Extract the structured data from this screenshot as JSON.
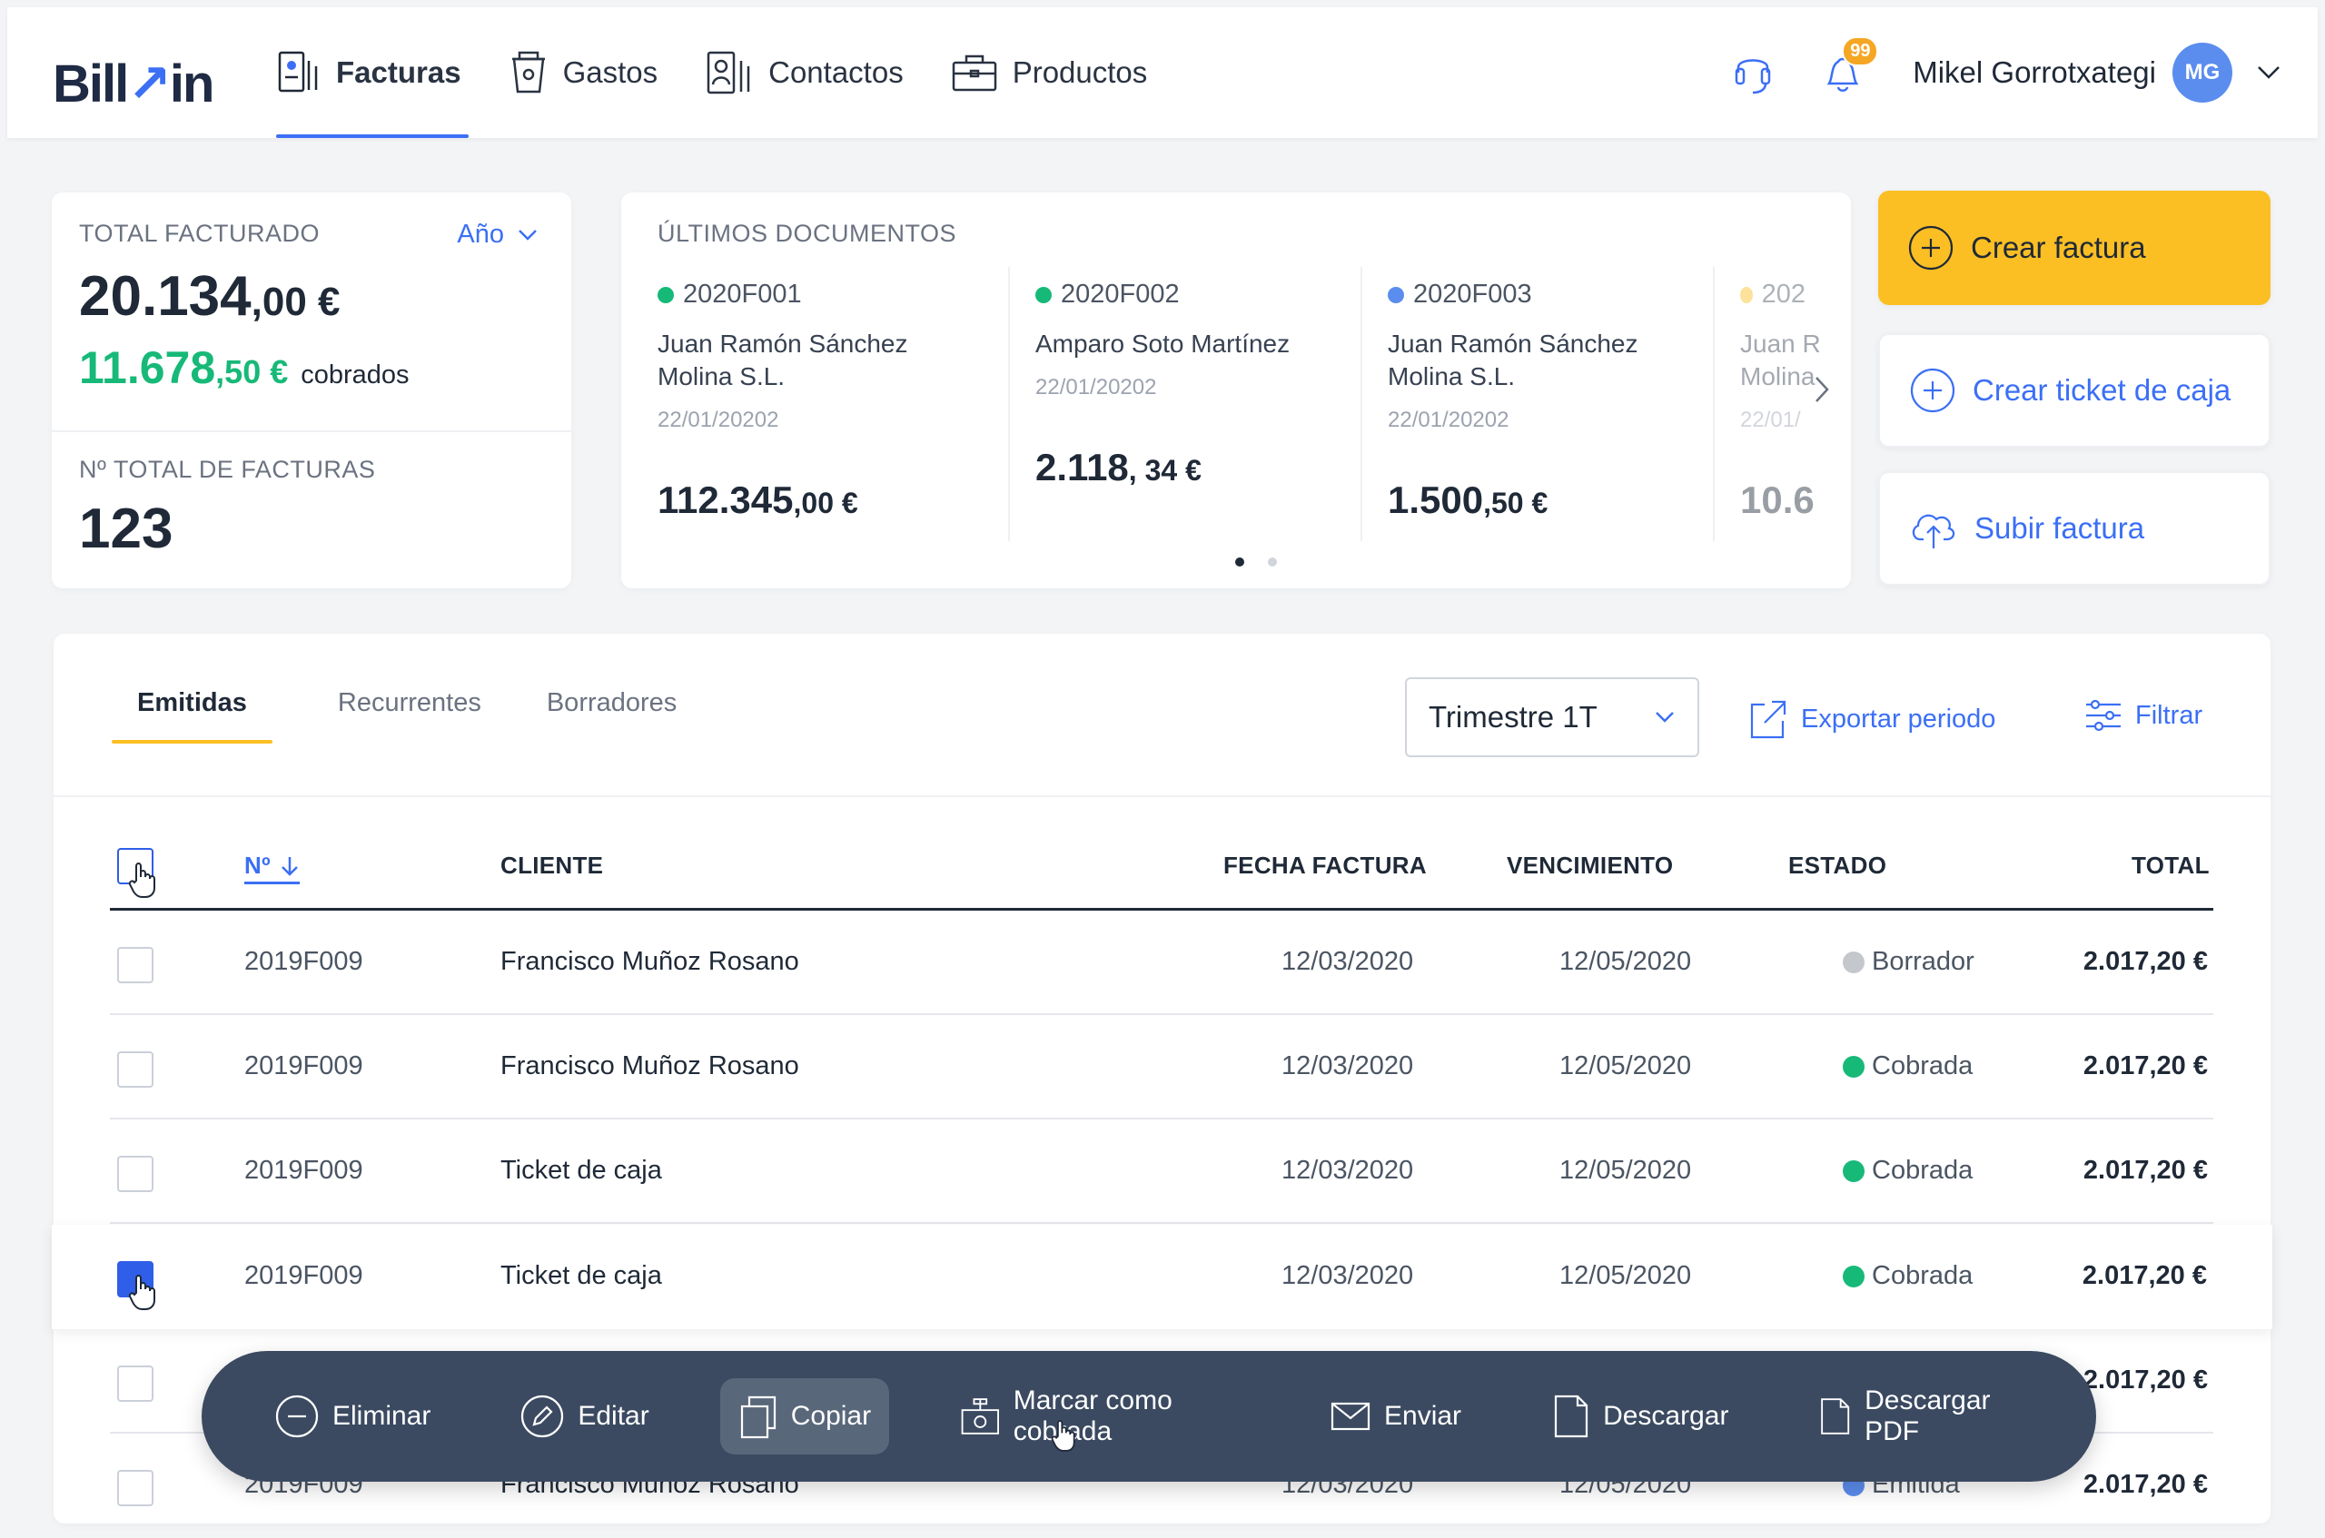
{
  "app": {
    "logo_text": "Billin"
  },
  "nav": {
    "items": [
      {
        "label": "Facturas",
        "active": true
      },
      {
        "label": "Gastos"
      },
      {
        "label": "Contactos"
      },
      {
        "label": "Productos"
      }
    ]
  },
  "header": {
    "notifications_count": "99",
    "user_name": "Mikel Gorrotxategi",
    "user_initials": "MG"
  },
  "summary": {
    "total_label": "TOTAL FACTURADO",
    "period_label": "Año",
    "total_int": "20.134",
    "total_dec": ",00 €",
    "paid_int": "11.678",
    "paid_dec": ",50 €",
    "paid_label": "cobrados",
    "count_label": "Nº TOTAL DE FACTURAS",
    "count_value": "123"
  },
  "recent_docs": {
    "title": "ÚLTIMOS DOCUMENTOS",
    "items": [
      {
        "number": "2020F001",
        "client": "Juan Ramón Sánchez Molina S.L.",
        "date": "22/01/20202",
        "amount_int": "112.345",
        "amount_dec": ",00 €",
        "color": "#17b978"
      },
      {
        "number": "2020F002",
        "client": "Amparo Soto Martínez",
        "date": "22/01/20202",
        "amount_int": "2.118",
        "amount_dec": ", 34 €",
        "color": "#17b978"
      },
      {
        "number": "2020F003",
        "client": "Juan Ramón Sánchez Molina S.L.",
        "date": "22/01/20202",
        "amount_int": "1.500",
        "amount_dec": ",50 €",
        "color": "#5b8def"
      },
      {
        "number": "202",
        "client": "Juan R Molina",
        "date": "22/01/",
        "amount_int": "10.6",
        "amount_dec": "",
        "color": "#fbbf24"
      }
    ]
  },
  "actions": {
    "create_invoice": "Crear factura",
    "create_ticket": "Crear ticket de caja",
    "upload_invoice": "Subir factura"
  },
  "table": {
    "tabs": [
      {
        "label": "Emitidas",
        "active": true
      },
      {
        "label": "Recurrentes"
      },
      {
        "label": "Borradores"
      }
    ],
    "period_value": "Trimestre 1T",
    "export_label": "Exportar periodo",
    "filter_label": "Filtrar",
    "columns": {
      "number": "Nº",
      "client": "CLIENTE",
      "date": "FECHA FACTURA",
      "due": "VENCIMIENTO",
      "status": "ESTADO",
      "total": "TOTAL"
    },
    "rows": [
      {
        "number": "2019F009",
        "client": "Francisco Muñoz Rosano",
        "date": "12/03/2020",
        "due": "12/05/2020",
        "status": "Borrador",
        "status_color": "#c4c7cc",
        "total": "2.017,20 €",
        "checked": false
      },
      {
        "number": "2019F009",
        "client": "Francisco Muñoz Rosano",
        "date": "12/03/2020",
        "due": "12/05/2020",
        "status": "Cobrada",
        "status_color": "#17b978",
        "total": "2.017,20 €",
        "checked": false
      },
      {
        "number": "2019F009",
        "client": "Ticket de caja",
        "date": "12/03/2020",
        "due": "12/05/2020",
        "status": "Cobrada",
        "status_color": "#17b978",
        "total": "2.017,20 €",
        "checked": false
      },
      {
        "number": "2019F009",
        "client": "Ticket de caja",
        "date": "12/03/2020",
        "due": "12/05/2020",
        "status": "Cobrada",
        "status_color": "#17b978",
        "total": "2.017,20 €",
        "checked": true
      },
      {
        "number": "",
        "client": "",
        "date": "",
        "due": "",
        "status": "",
        "status_color": "#17b978",
        "total": "2.017,20 €",
        "checked": false
      },
      {
        "number": "2019F009",
        "client": "Francisco Muñoz Rosano",
        "date": "12/03/2020",
        "due": "12/05/2020",
        "status": "Emitida",
        "status_color": "#5b8def",
        "total": "2.017,20 €",
        "checked": false
      }
    ]
  },
  "bulk_actions": {
    "delete": "Eliminar",
    "edit": "Editar",
    "copy": "Copiar",
    "mark_paid": "Marcar como cobrada",
    "send": "Enviar",
    "download": "Descargar",
    "download_pdf": "Descargar PDF"
  },
  "colors": {
    "accent": "#3b6ff5",
    "primary_button": "#fbbf24",
    "paid": "#17b978",
    "bulk_bar": "#3b4a61"
  }
}
